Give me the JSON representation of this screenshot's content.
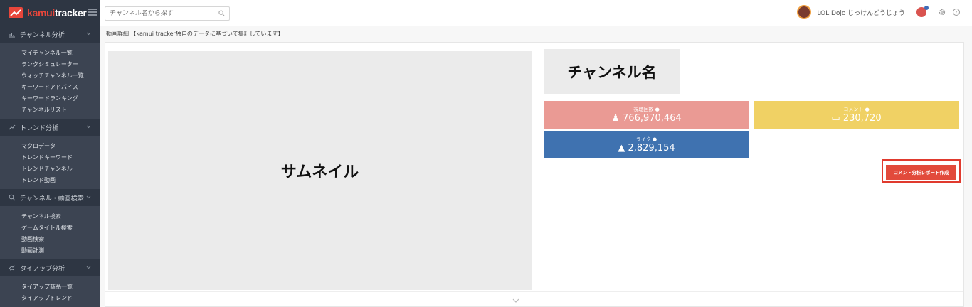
{
  "brand": {
    "logo_prefix": "kamui",
    "logo_suffix": "tracker",
    "accent": "#e8463b"
  },
  "search": {
    "placeholder": "チャンネル名から探す"
  },
  "user": {
    "name": "LOL Dojo じっけんどうじょう"
  },
  "sidebar": {
    "sections": [
      {
        "title": "チャンネル分析",
        "icon": "bar-chart-icon",
        "items": [
          "マイチャンネル一覧",
          "ランクシミュレーター",
          "ウォッチチャンネル一覧",
          "キーワードアドバイス",
          "キーワードランキング",
          "チャンネルリスト"
        ]
      },
      {
        "title": "トレンド分析",
        "icon": "trend-line-icon",
        "items": [
          "マクロデータ",
          "トレンドキーワード",
          "トレンドチャンネル",
          "トレンド動画"
        ]
      },
      {
        "title": "チャンネル・動画検索",
        "icon": "search-icon",
        "items": [
          "チャンネル検索",
          "ゲームタイトル検索",
          "動画検索",
          "動画計測"
        ]
      },
      {
        "title": "タイアップ分析",
        "icon": "handshake-icon",
        "items": [
          "タイアップ商品一覧",
          "タイアップトレンド"
        ]
      }
    ]
  },
  "breadcrumb": "動画詳細 【kamui tracker独自のデータに基づいて集計しています】",
  "main": {
    "thumbnail_label": "サムネイル",
    "channel_name": "チャンネル名",
    "stats": {
      "views": {
        "label": "視聴回数",
        "value": "766,970,464",
        "color": "#ea9a94"
      },
      "comments": {
        "label": "コメント",
        "value": "230,720",
        "color": "#f0d164"
      },
      "likes": {
        "label": "ライク",
        "value": "2,829,154",
        "color": "#3f72b0"
      }
    },
    "report_button": "コメント分析レポート作成"
  }
}
